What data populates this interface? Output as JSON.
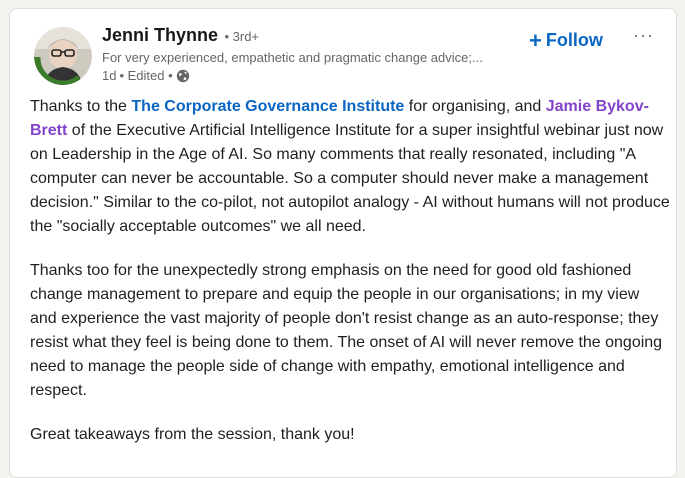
{
  "author": {
    "name": "Jenni Thynne",
    "degree": "• 3rd+",
    "headline": "For very experienced, empathetic and pragmatic change advice;...",
    "time": "1d",
    "edited": "• Edited •",
    "avatar_badge": "#OPENTOWORK"
  },
  "actions": {
    "follow_icon": "+",
    "follow_label": "Follow",
    "more_label": "···"
  },
  "post": {
    "p1_a": "Thanks to the ",
    "mention_org": "The Corporate Governance Institute",
    "p1_b": " for organising, and ",
    "mention_person": "Jamie Bykov-Brett",
    "p1_c": " of the Executive Artificial Intelligence Institute for a super insightful webinar just now on Leadership in the Age of AI. So many comments that really resonated, including \"A computer can never be accountable. So a computer should never make a management decision.\" Similar to the co-pilot, not autopilot analogy - AI without humans will not produce the \"socially acceptable outcomes\" we all need.",
    "p2": "Thanks too for the unexpectedly strong emphasis on the need for good old fashioned change management to prepare and equip the people in our organisations; in my view and experience the vast majority of people don't resist change as an auto-response; they resist what they feel is being done to them. The onset of AI will never remove the ongoing need to manage the people side of change with empathy, emotional intelligence and respect.",
    "p3": "Great takeaways from the session, thank you!"
  },
  "colors": {
    "link_blue": "#0a66c2",
    "mention_purple": "#8344cc",
    "open_to_work_green": "#3a7b2c"
  },
  "icons": {
    "visibility": "globe-icon",
    "more": "more-horizontal-icon"
  }
}
